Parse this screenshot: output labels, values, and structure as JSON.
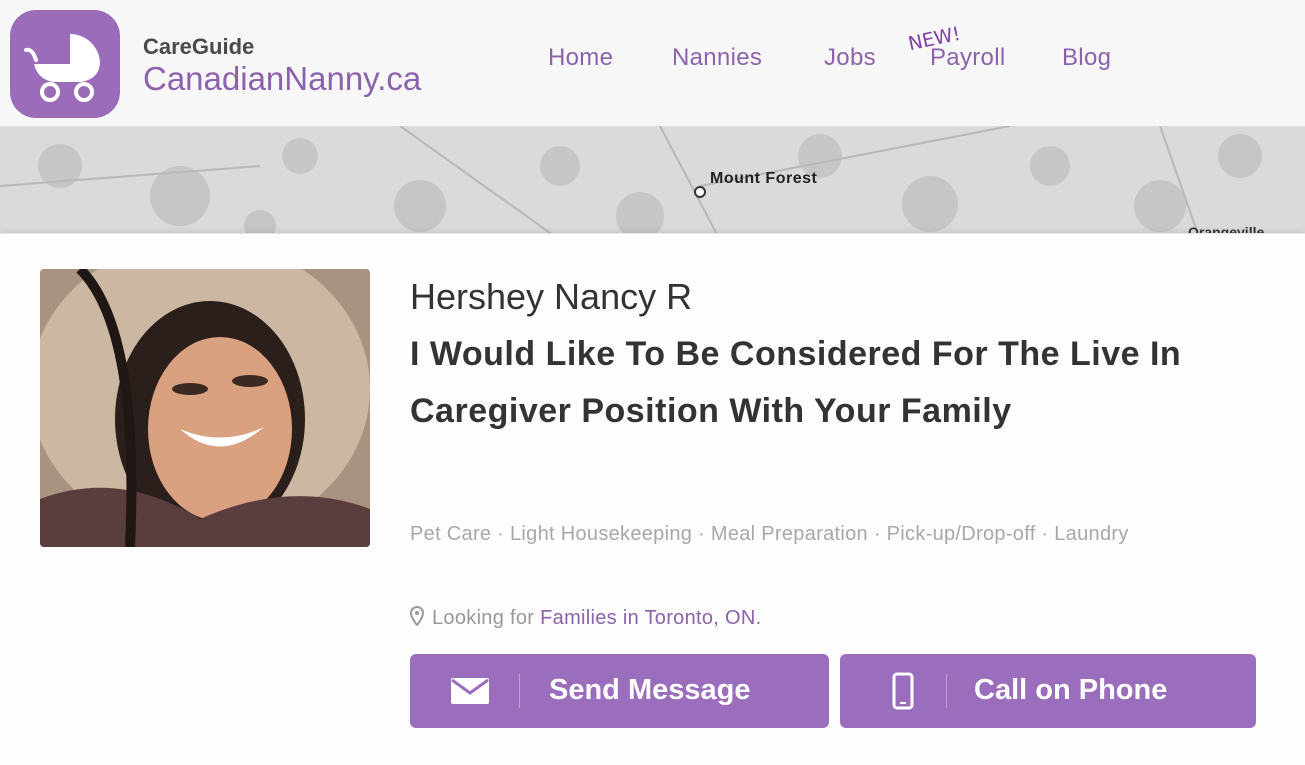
{
  "brand": {
    "small": "CareGuide",
    "name": "CanadianNanny.ca",
    "accent": "#9a6cba"
  },
  "nav": {
    "items": [
      {
        "label": "Home"
      },
      {
        "label": "Nannies"
      },
      {
        "label": "Jobs"
      },
      {
        "label": "Payroll"
      },
      {
        "label": "Blog"
      }
    ],
    "new_badge": "NEW!"
  },
  "map": {
    "label": "Mount Forest",
    "partial_label": "Orangeville"
  },
  "profile": {
    "name": "Hershey Nancy R",
    "headline": "I Would Like To Be Considered For The Live In Caregiver Position With Your Family",
    "skills": "Pet Care · Light Housekeeping · Meal Preparation · Pick-up/Drop-off · Laundry",
    "location_prefix": "Looking for",
    "location_link": "Families in Toronto, ON."
  },
  "actions": {
    "send_message": "Send Message",
    "call_phone": "Call on Phone"
  },
  "icons": {
    "logo": "baby-stroller-icon",
    "location": "map-pin-icon",
    "message": "envelope-icon",
    "phone": "mobile-phone-icon"
  }
}
